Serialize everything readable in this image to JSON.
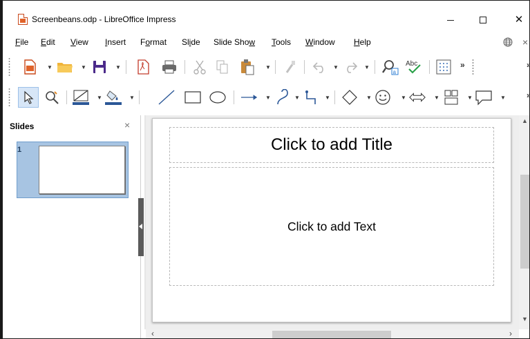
{
  "window": {
    "title": "Screenbeans.odp - LibreOffice Impress",
    "minimize_glyph": "",
    "maximize_glyph": "",
    "close_glyph": "✕"
  },
  "menu": {
    "items": [
      {
        "u": "F",
        "rest": "ile"
      },
      {
        "pre": "",
        "u": "E",
        "rest": "dit"
      },
      {
        "u": "V",
        "rest": "iew"
      },
      {
        "u": "I",
        "rest": "nsert"
      },
      {
        "pre": "F",
        "u": "o",
        "rest": "rmat"
      },
      {
        "pre": "Sl",
        "u": "i",
        "rest": "de"
      },
      {
        "pre": "Slide Sho",
        "u": "w",
        "rest": ""
      },
      {
        "u": "T",
        "rest": "ools"
      },
      {
        "u": "W",
        "rest": "indow"
      },
      {
        "u": "H",
        "rest": "elp"
      }
    ],
    "right_close": "×"
  },
  "toolbar_standard": {
    "more_label": "»"
  },
  "toolbar_drawing": {
    "more_label": "»"
  },
  "slides_pane": {
    "title": "Slides",
    "close_label": "×",
    "slides": [
      {
        "number": "1"
      }
    ]
  },
  "slide": {
    "title_placeholder": "Click to add Title",
    "text_placeholder": "Click to add Text"
  },
  "colors": {
    "accent_blue": "#2b5797",
    "selection_blue": "#a7c4e2",
    "doc_orange": "#e0632a",
    "save_purple": "#4b2a8a"
  },
  "icons": [
    "new-document-icon",
    "open-folder-icon",
    "save-icon",
    "export-pdf-icon",
    "print-icon",
    "cut-icon",
    "copy-icon",
    "paste-icon",
    "clone-formatting-icon",
    "undo-icon",
    "redo-icon",
    "find-replace-icon",
    "spellcheck-icon",
    "grid-icon",
    "select-arrow-icon",
    "zoom-pan-icon",
    "line-color-icon",
    "fill-color-icon",
    "line-icon",
    "rectangle-icon",
    "ellipse-icon",
    "arrow-line-icon",
    "curve-icon",
    "connector-icon",
    "basic-shapes-icon",
    "symbol-shapes-icon",
    "block-arrows-icon",
    "flowchart-icon",
    "callout-icon"
  ]
}
